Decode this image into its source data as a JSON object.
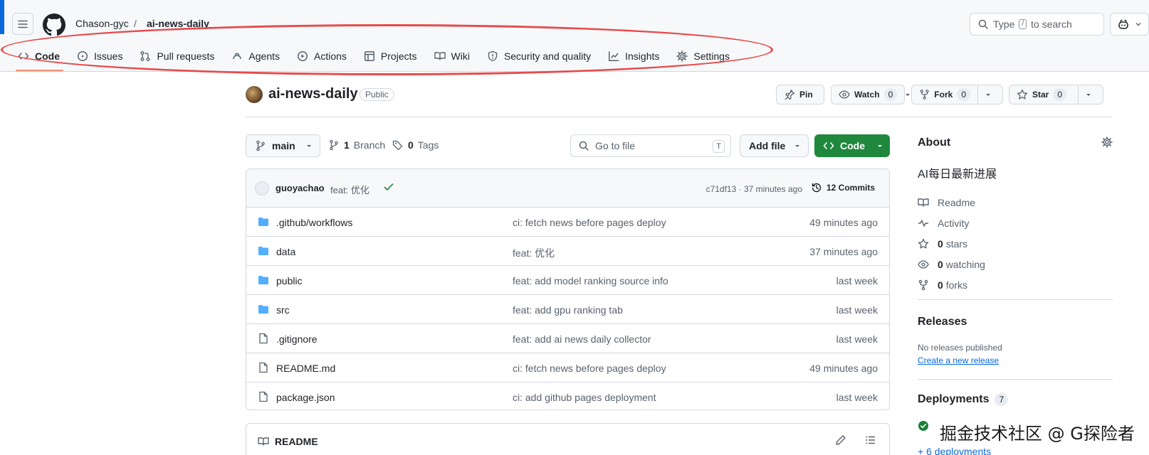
{
  "header": {
    "owner": "Chason-gyc",
    "separator": "/",
    "repo": "ai-news-daily",
    "search_placeholder_pre": "Type",
    "search_key": "/",
    "search_placeholder_post": "to search"
  },
  "nav": {
    "items": [
      {
        "label": "Code",
        "icon": "code-icon",
        "active": true
      },
      {
        "label": "Issues",
        "icon": "issue-icon"
      },
      {
        "label": "Pull requests",
        "icon": "pull-request-icon"
      },
      {
        "label": "Agents",
        "icon": "agents-icon"
      },
      {
        "label": "Actions",
        "icon": "play-icon"
      },
      {
        "label": "Projects",
        "icon": "table-icon"
      },
      {
        "label": "Wiki",
        "icon": "book-icon"
      },
      {
        "label": "Security and quality",
        "icon": "shield-icon"
      },
      {
        "label": "Insights",
        "icon": "graph-icon"
      },
      {
        "label": "Settings",
        "icon": "gear-icon"
      }
    ]
  },
  "repo_head": {
    "name": "ai-news-daily",
    "visibility": "Public",
    "pin_label": "Pin",
    "watch_label": "Watch",
    "watch_count": "0",
    "fork_label": "Fork",
    "fork_count": "0",
    "star_label": "Star",
    "star_count": "0"
  },
  "toolbar": {
    "branch": "main",
    "branch_count": "1",
    "branch_label": "Branch",
    "tag_count": "0",
    "tag_label": "Tags",
    "file_search_placeholder": "Go to file",
    "file_search_key": "T",
    "add_file_label": "Add file",
    "code_label": "Code"
  },
  "latest_commit": {
    "author": "guoyachao",
    "message": "feat: 优化",
    "hash_time": "c71df13 · 37 minutes ago",
    "commits_label": "12 Commits"
  },
  "files": [
    {
      "name": ".github/workflows",
      "type": "folder",
      "commit": "ci: fetch news before pages deploy",
      "time": "49 minutes ago"
    },
    {
      "name": "data",
      "type": "folder",
      "commit": "feat: 优化",
      "time": "37 minutes ago"
    },
    {
      "name": "public",
      "type": "folder",
      "commit": "feat: add model ranking source info",
      "time": "last week"
    },
    {
      "name": "src",
      "type": "folder",
      "commit": "feat: add gpu ranking tab",
      "time": "last week"
    },
    {
      "name": ".gitignore",
      "type": "file",
      "commit": "feat: add ai news daily collector",
      "time": "last week"
    },
    {
      "name": "README.md",
      "type": "file",
      "commit": "ci: fetch news before pages deploy",
      "time": "49 minutes ago"
    },
    {
      "name": "package.json",
      "type": "file",
      "commit": "ci: add github pages deployment",
      "time": "last week"
    }
  ],
  "readme": {
    "title": "README"
  },
  "sidebar": {
    "about_title": "About",
    "description": "AI每日最新进展",
    "readme_label": "Readme",
    "activity_label": "Activity",
    "stars_count": "0",
    "stars_label": "stars",
    "watching_count": "0",
    "watching_label": "watching",
    "forks_count": "0",
    "forks_label": "forks",
    "releases_title": "Releases",
    "releases_none": "No releases published",
    "releases_create": "Create a new release",
    "deployments_title": "Deployments",
    "deployments_count": "7",
    "deployments_more": "+ 6 deployments"
  },
  "watermark": "掘金技术社区 @ G探险者",
  "colors": {
    "accent": "#0969da",
    "green": "#1f883d",
    "annotation": "#e84a4a",
    "active_tab": "#fd8c73"
  }
}
